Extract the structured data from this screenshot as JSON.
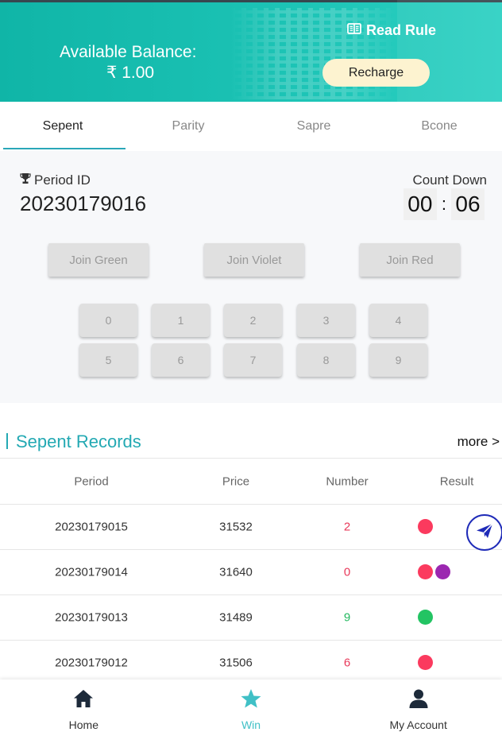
{
  "header": {
    "balance_label": "Available Balance:",
    "balance_value": "₹ 1.00",
    "read_rule_label": "Read Rule",
    "recharge_label": "Recharge",
    "icons": {
      "read_rule": "book-icon"
    }
  },
  "tabs": [
    {
      "label": "Sepent",
      "active": true
    },
    {
      "label": "Parity",
      "active": false
    },
    {
      "label": "Sapre",
      "active": false
    },
    {
      "label": "Bcone",
      "active": false
    }
  ],
  "game": {
    "period_label": "Period ID",
    "period_value": "20230179016",
    "countdown_label": "Count Down",
    "timer": {
      "minutes": "00",
      "separator": ":",
      "seconds": "06"
    },
    "join_buttons": [
      "Join Green",
      "Join Violet",
      "Join Red"
    ],
    "numbers": [
      "0",
      "1",
      "2",
      "3",
      "4",
      "5",
      "6",
      "7",
      "8",
      "9"
    ]
  },
  "records": {
    "title": "Sepent Records",
    "more_label": "more >",
    "columns": [
      "Period",
      "Price",
      "Number",
      "Result"
    ],
    "rows": [
      {
        "period": "20230179015",
        "price": "31532",
        "number": "2",
        "number_color": "#e8395a",
        "result": [
          "#fb3a5e"
        ]
      },
      {
        "period": "20230179014",
        "price": "31640",
        "number": "0",
        "number_color": "#e8395a",
        "result": [
          "#fb3a5e",
          "#9b27b0"
        ]
      },
      {
        "period": "20230179013",
        "price": "31489",
        "number": "9",
        "number_color": "#23b85f",
        "result": [
          "#23c463"
        ]
      },
      {
        "period": "20230179012",
        "price": "31506",
        "number": "6",
        "number_color": "#e8395a",
        "result": [
          "#fb3a5e"
        ]
      }
    ]
  },
  "bottom_nav": [
    {
      "label": "Home",
      "icon": "home-icon",
      "active": false
    },
    {
      "label": "Win",
      "icon": "star-icon",
      "active": true
    },
    {
      "label": "My Account",
      "icon": "user-icon",
      "active": false
    }
  ],
  "floating": {
    "icon": "send-icon",
    "color": "#1f2bb8"
  },
  "colors": {
    "brand": "#1dc4b6",
    "accent": "#23a9b3"
  }
}
